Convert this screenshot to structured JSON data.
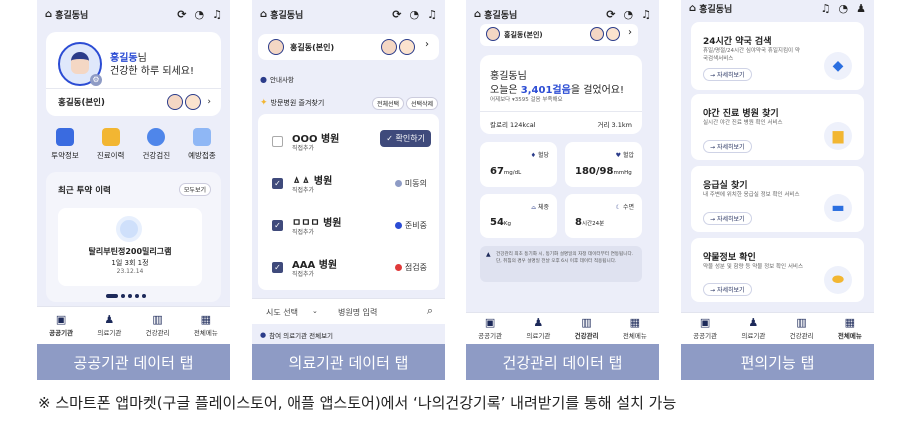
{
  "panels": [
    {
      "caption": "공공기관 데이터 탭",
      "header_title": "홍길동님",
      "profile": {
        "name_suffix": "님",
        "name": "홍길동",
        "greeting": "건강한 하루 되세요!"
      },
      "member_row": "홍길동(본인)",
      "shortcuts": [
        "투약정보",
        "진료이력",
        "건강검진",
        "예방접종"
      ],
      "recent_title": "최근 투약 이력",
      "recent_more": "모두보기",
      "drug_name": "탈리부틴정200밀리그램",
      "drug_dose": "1일 3회 1정",
      "drug_date": "23.12.14"
    },
    {
      "caption": "의료기관 데이터 탭",
      "header_title": "홍길동님",
      "member_row": "홍길동(본인)",
      "notice": "안내사항",
      "fav_title": "방문병원 즐겨찾기",
      "fav_select": "전체선택",
      "fav_delete": "선택삭제",
      "hospitals": [
        {
          "name": "OOO 병원",
          "sub": "직접추가",
          "status": "확인하기"
        },
        {
          "name": "ㅿㅿ 병원",
          "sub": "직접추가",
          "status": "미동의"
        },
        {
          "name": "ㅁㅁㅁ 병원",
          "sub": "직접추가",
          "status": "준비중"
        },
        {
          "name": "AAA 병원",
          "sub": "직접추가",
          "status": "점검중"
        }
      ],
      "region_placeholder": "시도 선택",
      "hospital_placeholder": "병원명 입력",
      "participating": "참여 의료기관 전체보기"
    },
    {
      "caption": "건강관리 데이터 탭",
      "header_title": "홍길동님",
      "member_row": "홍길동(본인)",
      "walk_name": "홍길동님",
      "walk_prefix": "오늘은 ",
      "walk_steps": "3,401걸음",
      "walk_suffix": "을 걸었어요!",
      "walk_compare": "어제보다 ▾3595 걸음 부족해요",
      "calorie": "칼로리 124kcal",
      "distance": "거리 3.1km",
      "metrics": [
        {
          "label": "혈당",
          "value": "67",
          "unit": "mg/dL"
        },
        {
          "label": "혈압",
          "value": "180/98",
          "unit": "mmHg"
        },
        {
          "label": "체중",
          "value": "54",
          "unit": "Kg"
        },
        {
          "label": "수면",
          "value": "8",
          "unit": "시간24분"
        }
      ],
      "notice": "건강관리 최초 동기화 시, 동기화 설명일의 자정 데이터부터 연동됩니다. 단, 취침의 경우 설명일 전날 오후 6시 이후 데이터 적용됩니다."
    },
    {
      "caption": "편의기능 탭",
      "header_title": "홍길동님",
      "cards": [
        {
          "title": "24시간 약국 검색",
          "desc": "휴일/명절/24시간 심야약국 휴일지킴이 약국검색서비스",
          "link": "자세히보기"
        },
        {
          "title": "야간 진료 병원 찾기",
          "desc": "실시간 야간 진료 병원 확인 서비스",
          "link": "자세히보기"
        },
        {
          "title": "응급실 찾기",
          "desc": "내 주변에 위치한 응급실 정보 확인 서비스",
          "link": "자세히보기"
        },
        {
          "title": "약물정보 확인",
          "desc": "약물 성분 및 함량 등 약물 정보 확인 서비스",
          "link": "자세히보기"
        }
      ]
    }
  ],
  "nav": [
    "공공기관",
    "의료기관",
    "건강관리",
    "전체메뉴"
  ],
  "footer_note": "※ 스마트폰 앱마켓(구글 플레이스토어, 애플 앱스토어)에서 ‘나의건강기록’ 내려받기를 통해 설치 가능"
}
